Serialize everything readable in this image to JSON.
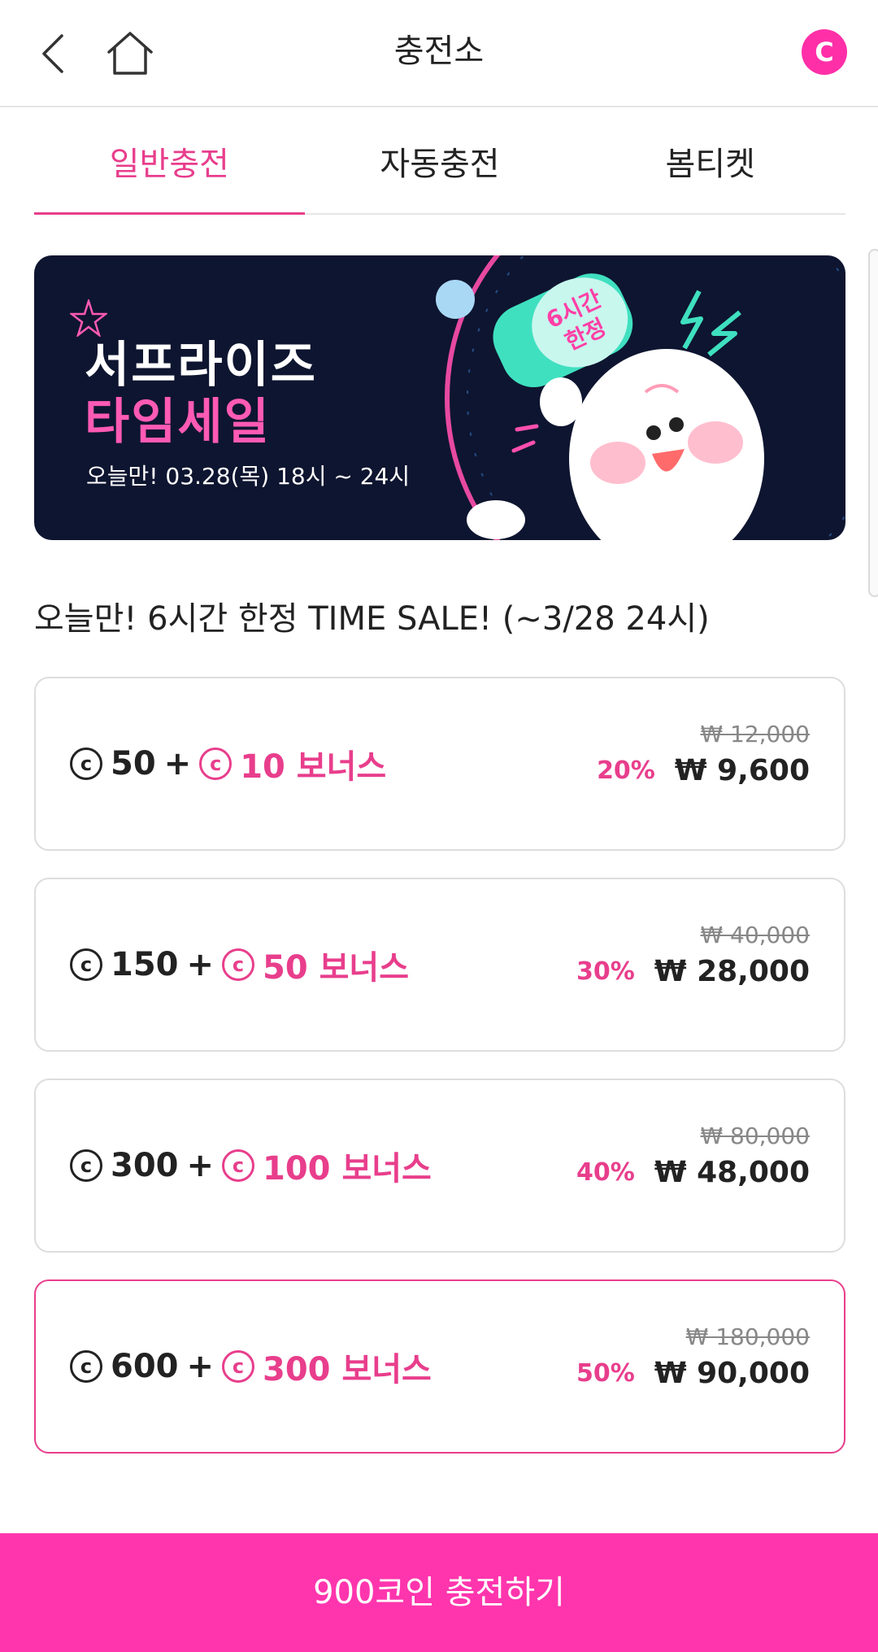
{
  "header": {
    "title": "충전소",
    "back_icon": "chevron-left-icon",
    "home_icon": "home-icon",
    "coin_icon": "coin-icon",
    "coin_icon_letter": "C"
  },
  "tabs": [
    {
      "label": "일반충전",
      "active": true
    },
    {
      "label": "자동충전",
      "active": false
    },
    {
      "label": "봄티켓",
      "active": false
    }
  ],
  "banner": {
    "line1": "서프라이즈",
    "line2": "타임세일",
    "subtitle": "오늘만! 03.28(목) 18시 ~ 24시",
    "clock_text_1": "6시간",
    "clock_text_2": "한정"
  },
  "section_title": "오늘만! 6시간 한정 TIME SALE! (~3/28 24시)",
  "coin_symbol": "c",
  "options": [
    {
      "base": "50",
      "bonus": "10 보너스",
      "original_price": "₩ 12,000",
      "discount": "20%",
      "price": "₩ 9,600",
      "selected": false
    },
    {
      "base": "150",
      "bonus": "50 보너스",
      "original_price": "₩ 40,000",
      "discount": "30%",
      "price": "₩ 28,000",
      "selected": false
    },
    {
      "base": "300",
      "bonus": "100 보너스",
      "original_price": "₩ 80,000",
      "discount": "40%",
      "price": "₩ 48,000",
      "selected": false
    },
    {
      "base": "600",
      "bonus": "300 보너스",
      "original_price": "₩ 180,000",
      "discount": "50%",
      "price": "₩ 90,000",
      "selected": true
    }
  ],
  "plus": "+",
  "cta_label": "900코인 충전하기",
  "colors": {
    "accent": "#e83e8c",
    "cta": "#ff35ad",
    "banner_bg": "#0e1530"
  }
}
